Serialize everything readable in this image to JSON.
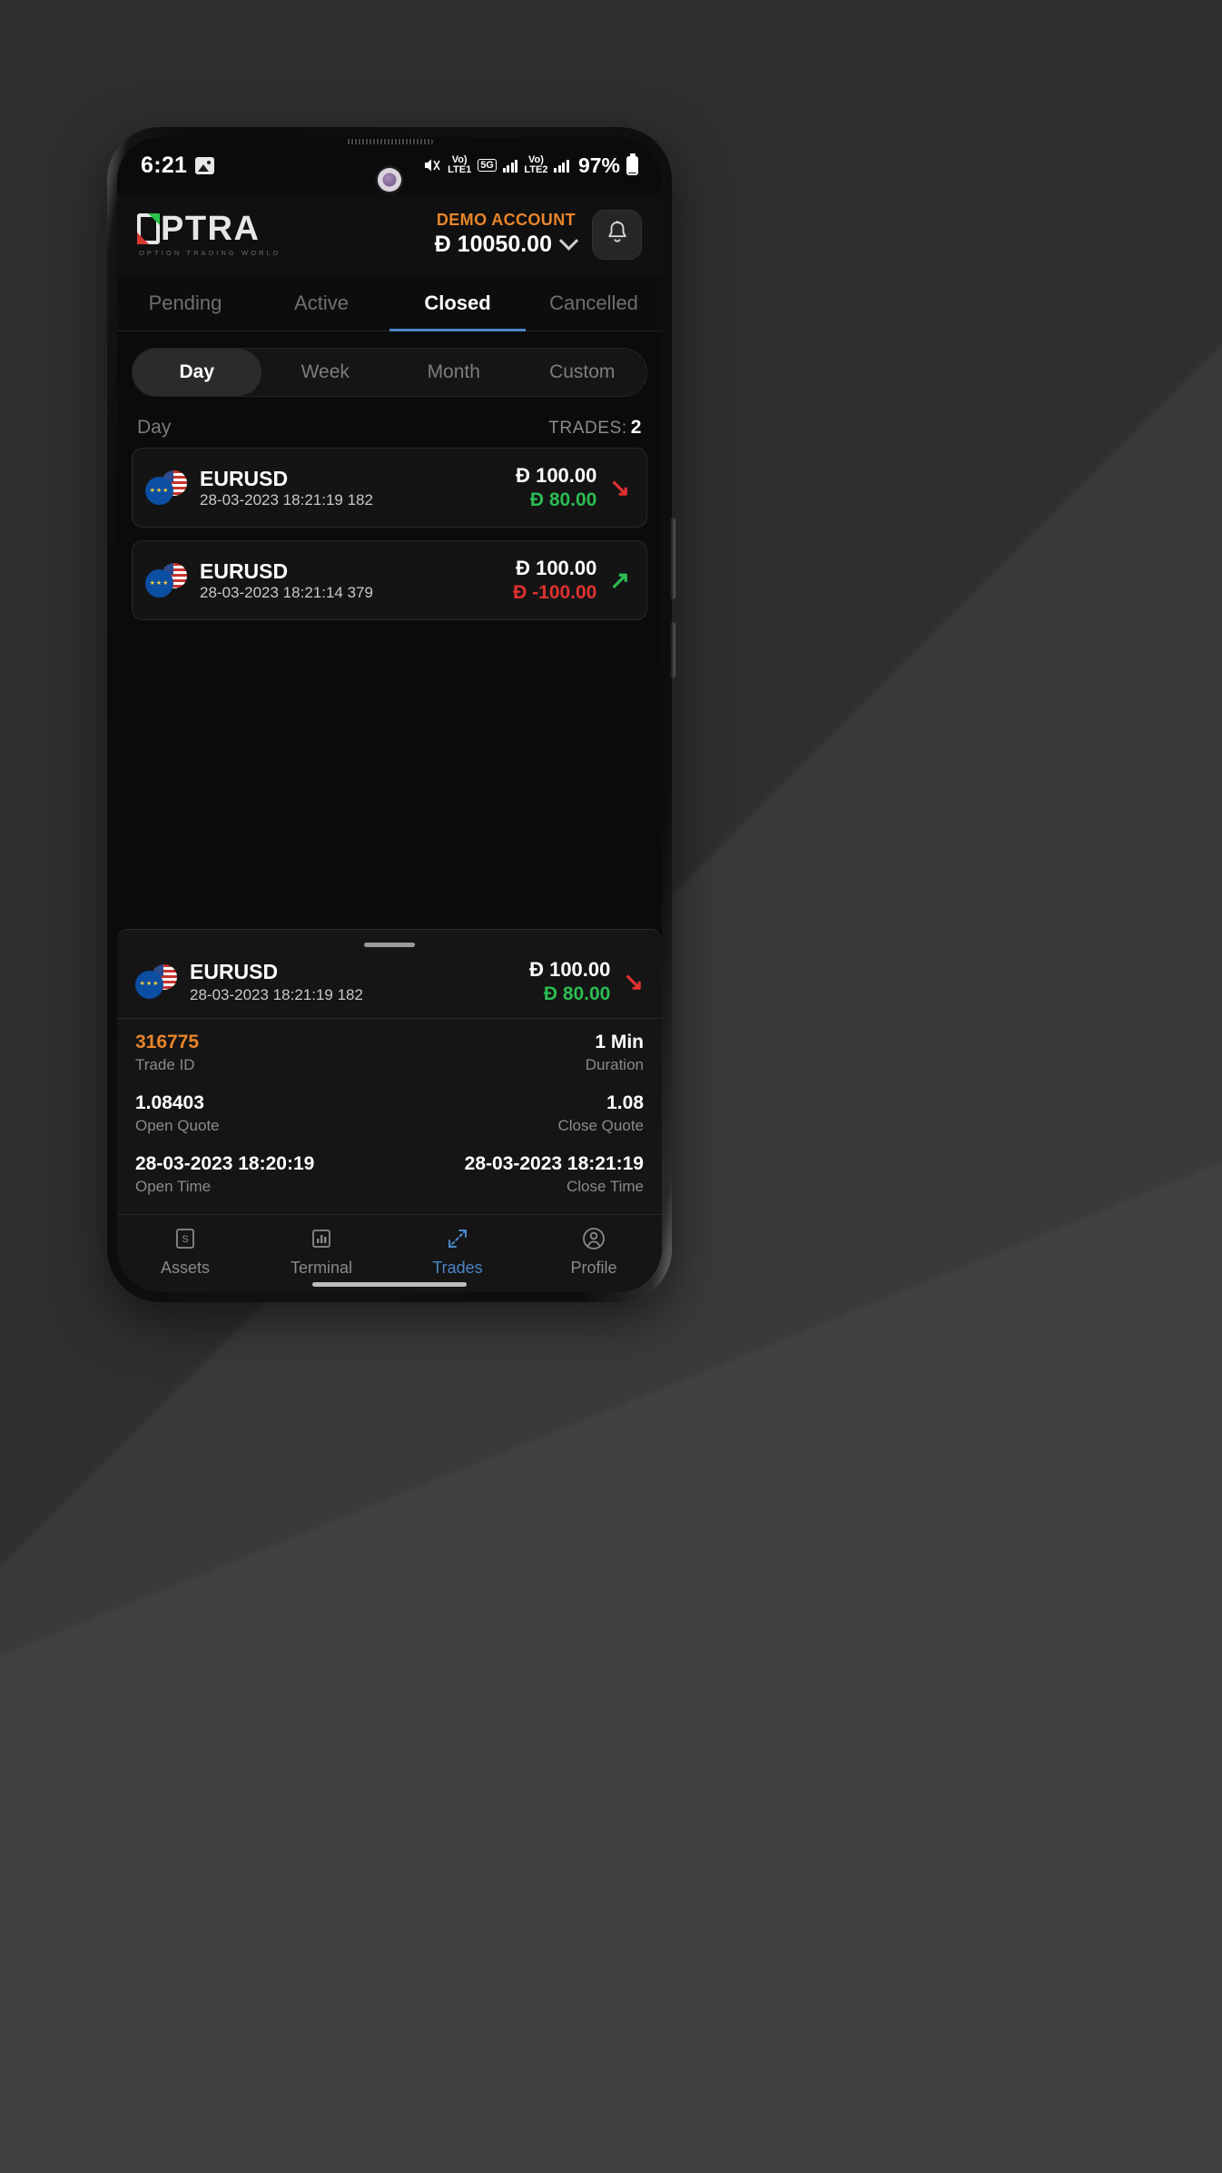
{
  "status_bar": {
    "time": "6:21",
    "image_icon": "image-icon",
    "mute_icon": "volume-mute-icon",
    "volte1": {
      "top": "Vo)",
      "bottom": "LTE1"
    },
    "network_5g": "5G",
    "volte2": {
      "top": "Vo)",
      "bottom": "LTE2"
    },
    "battery_percent": "97%"
  },
  "header": {
    "logo_text": "OPTRA",
    "logo_tagline": "OPTION TRADING WORLD",
    "account_label": "DEMO ACCOUNT",
    "balance": "Ð 10050.00",
    "chevron_icon": "chevron-down-icon",
    "bell_icon": "bell-icon"
  },
  "tabs": [
    {
      "label": "Pending",
      "active": false
    },
    {
      "label": "Active",
      "active": false
    },
    {
      "label": "Closed",
      "active": true
    },
    {
      "label": "Cancelled",
      "active": false
    }
  ],
  "period_segments": [
    {
      "label": "Day",
      "active": true
    },
    {
      "label": "Week",
      "active": false
    },
    {
      "label": "Month",
      "active": false
    },
    {
      "label": "Custom",
      "active": false
    }
  ],
  "list_header": {
    "period": "Day",
    "trades_label": "TRADES:",
    "trades_count": "2"
  },
  "trades": [
    {
      "symbol": "EURUSD",
      "timestamp": "28-03-2023 18:21:19 182",
      "stake": "Ð 100.00",
      "pl": "Ð 80.00",
      "pl_direction": "up",
      "arrow": "↘",
      "arrow_direction": "down",
      "flag_icon": "eurusd-flag-icon"
    },
    {
      "symbol": "EURUSD",
      "timestamp": "28-03-2023 18:21:14 379",
      "stake": "Ð 100.00",
      "pl": "Ð -100.00",
      "pl_direction": "down",
      "arrow": "↗",
      "arrow_direction": "up",
      "flag_icon": "eurusd-flag-icon"
    }
  ],
  "detail_sheet": {
    "symbol": "EURUSD",
    "timestamp": "28-03-2023 18:21:19 182",
    "stake": "Ð 100.00",
    "pl": "Ð 80.00",
    "arrow": "↘",
    "trade_id_value": "316775",
    "trade_id_label": "Trade ID",
    "duration_value": "1 Min",
    "duration_label": "Duration",
    "open_quote_value": "1.08403",
    "open_quote_label": "Open Quote",
    "close_quote_value": "1.08",
    "close_quote_label": "Close Quote",
    "open_time_value": "28-03-2023  18:20:19",
    "open_time_label": "Open Time",
    "close_time_value": "28-03-2023  18:21:19",
    "close_time_label": "Close Time"
  },
  "bottom_nav": [
    {
      "label": "Assets",
      "icon": "assets-icon",
      "active": false
    },
    {
      "label": "Terminal",
      "icon": "terminal-chart-icon",
      "active": false
    },
    {
      "label": "Trades",
      "icon": "trades-arrows-icon",
      "active": true
    },
    {
      "label": "Profile",
      "icon": "profile-person-icon",
      "active": false
    }
  ],
  "colors": {
    "accent_orange": "#e8852a",
    "accent_blue": "#4a87c9",
    "profit_green": "#2bbd52",
    "loss_red": "#e03131"
  }
}
